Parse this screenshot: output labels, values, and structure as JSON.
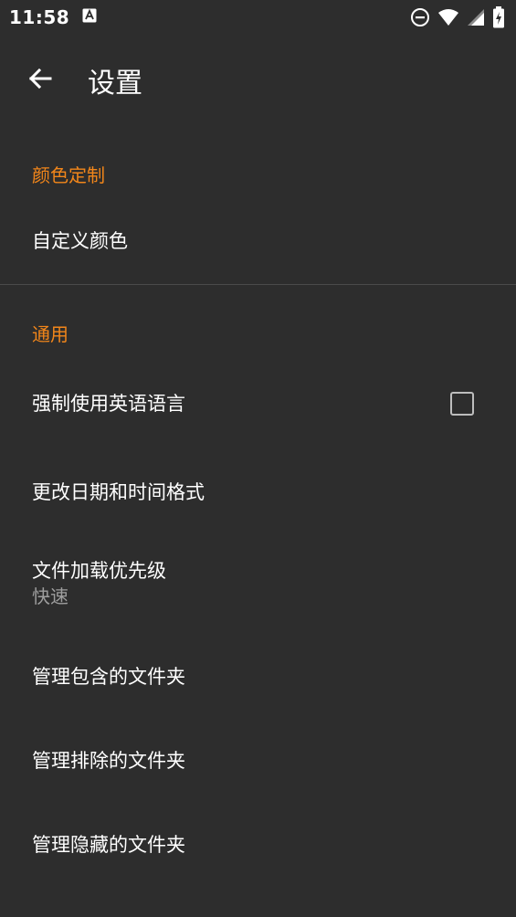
{
  "status_bar": {
    "time": "11:58",
    "icons": [
      "notification-a-icon",
      "do-not-disturb-icon",
      "wifi-icon",
      "signal-icon",
      "battery-charging-icon"
    ]
  },
  "toolbar": {
    "title": "设置",
    "back_icon": "arrow-back-icon"
  },
  "sections": {
    "color": {
      "header": "颜色定制",
      "items": {
        "custom_color": "自定义颜色"
      }
    },
    "general": {
      "header": "通用",
      "items": {
        "force_english": {
          "title": "强制使用英语语言",
          "checked": false
        },
        "date_format": {
          "title": "更改日期和时间格式"
        },
        "file_loading": {
          "title": "文件加载优先级",
          "summary": "快速"
        },
        "included_folders": {
          "title": "管理包含的文件夹"
        },
        "excluded_folders": {
          "title": "管理排除的文件夹"
        },
        "hidden_folders": {
          "title": "管理隐藏的文件夹"
        }
      }
    }
  },
  "colors": {
    "background": "#2d2d2d",
    "accent": "#f2861a",
    "text_primary": "#ffffff",
    "text_secondary": "#9e9e9e"
  }
}
